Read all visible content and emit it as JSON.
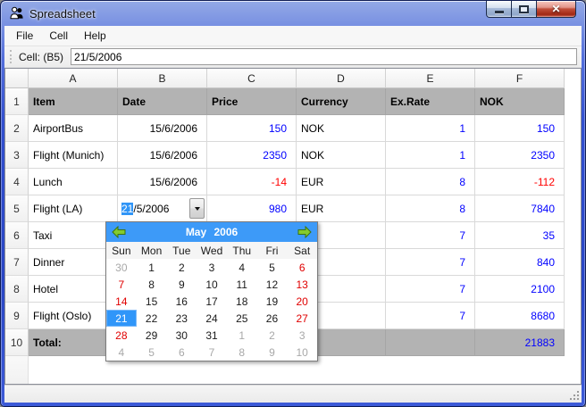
{
  "window": {
    "title": "Spreadsheet"
  },
  "menu": {
    "items": [
      "File",
      "Cell",
      "Help"
    ]
  },
  "toolbar": {
    "cell_label": "Cell: (B5)",
    "cell_value": "21/5/2006"
  },
  "spreadsheet": {
    "column_headers": [
      "A",
      "B",
      "C",
      "D",
      "E",
      "F"
    ],
    "rows": [
      {
        "num": "1",
        "item": "Item",
        "date": "Date",
        "price": "Price",
        "currency": "Currency",
        "exrate": "Ex.Rate",
        "nok": "NOK"
      },
      {
        "num": "2",
        "item": "AirportBus",
        "date": "15/6/2006",
        "price": "150",
        "currency": "NOK",
        "exrate": "1",
        "nok": "150"
      },
      {
        "num": "3",
        "item": "Flight (Munich)",
        "date": "15/6/2006",
        "price": "2350",
        "currency": "NOK",
        "exrate": "1",
        "nok": "2350"
      },
      {
        "num": "4",
        "item": "Lunch",
        "date": "15/6/2006",
        "price": "-14",
        "currency": "EUR",
        "exrate": "8",
        "nok": "-112"
      },
      {
        "num": "5",
        "item": "Flight (LA)",
        "price": "980",
        "currency": "EUR",
        "exrate": "8",
        "nok": "7840"
      },
      {
        "num": "6",
        "item": "Taxi",
        "exrate": "7",
        "nok": "35"
      },
      {
        "num": "7",
        "item": "Dinner",
        "exrate": "7",
        "nok": "840"
      },
      {
        "num": "8",
        "item": "Hotel",
        "exrate": "7",
        "nok": "2100"
      },
      {
        "num": "9",
        "item": "Flight (Oslo)",
        "exrate": "7",
        "nok": "8680"
      },
      {
        "num": "10",
        "item": "Total:",
        "nok": "21883"
      }
    ]
  },
  "date_editor": {
    "selected": "21",
    "rest": "/5/2006"
  },
  "calendar": {
    "title": "May 2006",
    "day_names": [
      "Sun",
      "Mon",
      "Tue",
      "Wed",
      "Thu",
      "Fri",
      "Sat"
    ],
    "weeks": [
      [
        "30",
        "1",
        "2",
        "3",
        "4",
        "5",
        "6"
      ],
      [
        "7",
        "8",
        "9",
        "10",
        "11",
        "12",
        "13"
      ],
      [
        "14",
        "15",
        "16",
        "17",
        "18",
        "19",
        "20"
      ],
      [
        "21",
        "22",
        "23",
        "24",
        "25",
        "26",
        "27"
      ],
      [
        "28",
        "29",
        "30",
        "31",
        "1",
        "2",
        "3"
      ],
      [
        "4",
        "5",
        "6",
        "7",
        "8",
        "9",
        "10"
      ]
    ],
    "selected_day": "21"
  },
  "colors": {
    "positive_number": "#0000ff",
    "negative_number": "#ff0000",
    "header_row_bg": "#b3b3b3",
    "calendar_header": "#3d9af8",
    "selection_blue": "#3096f9",
    "weekend_red": "#e00000",
    "out_of_month_gray": "#a8a8a8"
  }
}
